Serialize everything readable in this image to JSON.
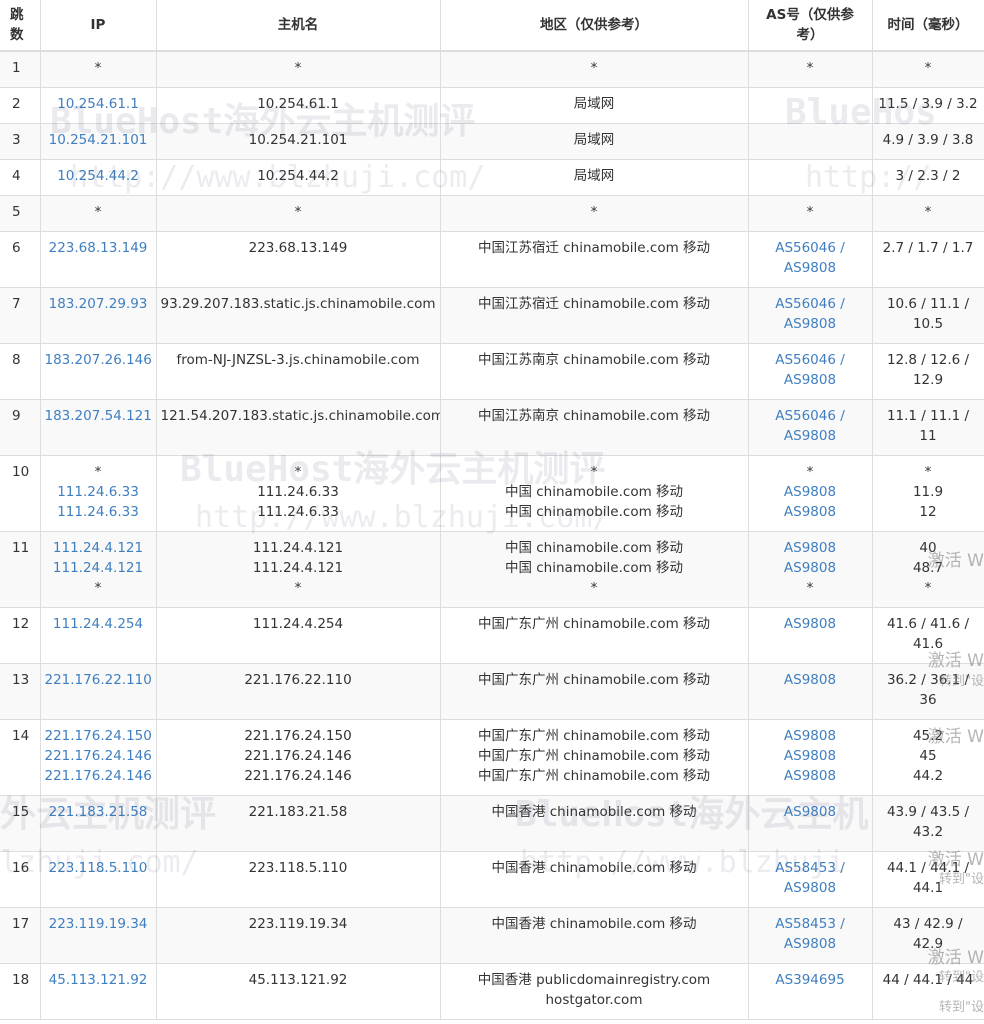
{
  "headers": {
    "hop": "跳\n数",
    "ip": "IP",
    "host": "主机名",
    "region": "地区（仅供参考）",
    "as": "AS号（仅供参\n考）",
    "time": "时间（毫秒）"
  },
  "rows": [
    {
      "hop": "1",
      "ip": [
        "*"
      ],
      "host": [
        "*"
      ],
      "region": [
        "*"
      ],
      "as": [
        "*"
      ],
      "time": [
        "*"
      ]
    },
    {
      "hop": "2",
      "ip": [
        "10.254.61.1"
      ],
      "host": [
        "10.254.61.1"
      ],
      "region": [
        "局域网"
      ],
      "as": [
        ""
      ],
      "time": [
        "11.5 / 3.9 / 3.2"
      ]
    },
    {
      "hop": "3",
      "ip": [
        "10.254.21.101"
      ],
      "host": [
        "10.254.21.101"
      ],
      "region": [
        "局域网"
      ],
      "as": [
        ""
      ],
      "time": [
        "4.9 / 3.9 / 3.8"
      ]
    },
    {
      "hop": "4",
      "ip": [
        "10.254.44.2"
      ],
      "host": [
        "10.254.44.2"
      ],
      "region": [
        "局域网"
      ],
      "as": [
        ""
      ],
      "time": [
        "3 / 2.3 / 2"
      ]
    },
    {
      "hop": "5",
      "ip": [
        "*"
      ],
      "host": [
        "*"
      ],
      "region": [
        "*"
      ],
      "as": [
        "*"
      ],
      "time": [
        "*"
      ]
    },
    {
      "hop": "6",
      "ip": [
        "223.68.13.149"
      ],
      "host": [
        "223.68.13.149"
      ],
      "region": [
        "中国江苏宿迁 chinamobile.com 移动"
      ],
      "as": [
        "AS56046 /",
        "AS9808"
      ],
      "time": [
        "2.7 / 1.7 / 1.7"
      ]
    },
    {
      "hop": "7",
      "ip": [
        "183.207.29.93"
      ],
      "host": [
        "93.29.207.183.static.js.chinamobile.com"
      ],
      "region": [
        "中国江苏宿迁 chinamobile.com 移动"
      ],
      "as": [
        "AS56046 /",
        "AS9808"
      ],
      "time": [
        "10.6 / 11.1 /",
        "10.5"
      ]
    },
    {
      "hop": "8",
      "ip": [
        "183.207.26.146"
      ],
      "host": [
        "from-NJ-JNZSL-3.js.chinamobile.com"
      ],
      "region": [
        "中国江苏南京 chinamobile.com 移动"
      ],
      "as": [
        "AS56046 /",
        "AS9808"
      ],
      "time": [
        "12.8 / 12.6 /",
        "12.9"
      ]
    },
    {
      "hop": "9",
      "ip": [
        "183.207.54.121"
      ],
      "host": [
        "121.54.207.183.static.js.chinamobile.com"
      ],
      "region": [
        "中国江苏南京 chinamobile.com 移动"
      ],
      "as": [
        "AS56046 /",
        "AS9808"
      ],
      "time": [
        "11.1 / 11.1 /",
        "11"
      ]
    },
    {
      "hop": "10",
      "ip": [
        "*",
        "111.24.6.33",
        "111.24.6.33"
      ],
      "host": [
        "*",
        "111.24.6.33",
        "111.24.6.33"
      ],
      "region": [
        "*",
        "中国 chinamobile.com 移动",
        "中国 chinamobile.com 移动"
      ],
      "as": [
        "*",
        "AS9808",
        "AS9808"
      ],
      "time": [
        "*",
        "11.9",
        "12"
      ]
    },
    {
      "hop": "11",
      "ip": [
        "111.24.4.121",
        "111.24.4.121",
        "*"
      ],
      "host": [
        "111.24.4.121",
        "111.24.4.121",
        "*"
      ],
      "region": [
        "中国 chinamobile.com 移动",
        "中国 chinamobile.com 移动",
        "*"
      ],
      "as": [
        "AS9808",
        "AS9808",
        "*"
      ],
      "time": [
        "40",
        "48.7",
        "*"
      ]
    },
    {
      "hop": "12",
      "ip": [
        "111.24.4.254"
      ],
      "host": [
        "111.24.4.254"
      ],
      "region": [
        "中国广东广州 chinamobile.com 移动"
      ],
      "as": [
        "AS9808"
      ],
      "time": [
        "41.6 / 41.6 /",
        "41.6"
      ]
    },
    {
      "hop": "13",
      "ip": [
        "221.176.22.110"
      ],
      "host": [
        "221.176.22.110"
      ],
      "region": [
        "中国广东广州 chinamobile.com 移动"
      ],
      "as": [
        "AS9808"
      ],
      "time": [
        "36.2 / 36.1 /",
        "36"
      ]
    },
    {
      "hop": "14",
      "ip": [
        "221.176.24.150",
        "221.176.24.146",
        "221.176.24.146"
      ],
      "host": [
        "221.176.24.150",
        "221.176.24.146",
        "221.176.24.146"
      ],
      "region": [
        "中国广东广州 chinamobile.com 移动",
        "中国广东广州 chinamobile.com 移动",
        "中国广东广州 chinamobile.com 移动"
      ],
      "as": [
        "AS9808",
        "AS9808",
        "AS9808"
      ],
      "time": [
        "45.2",
        "45",
        "44.2"
      ]
    },
    {
      "hop": "15",
      "ip": [
        "221.183.21.58"
      ],
      "host": [
        "221.183.21.58"
      ],
      "region": [
        "中国香港 chinamobile.com 移动"
      ],
      "as": [
        "AS9808"
      ],
      "time": [
        "43.9 / 43.5 /",
        "43.2"
      ]
    },
    {
      "hop": "16",
      "ip": [
        "223.118.5.110"
      ],
      "host": [
        "223.118.5.110"
      ],
      "region": [
        "中国香港 chinamobile.com 移动"
      ],
      "as": [
        "AS58453 /",
        "AS9808"
      ],
      "time": [
        "44.1 / 44.1 /",
        "44.1"
      ]
    },
    {
      "hop": "17",
      "ip": [
        "223.119.19.34"
      ],
      "host": [
        "223.119.19.34"
      ],
      "region": [
        "中国香港 chinamobile.com 移动"
      ],
      "as": [
        "AS58453 /",
        "AS9808"
      ],
      "time": [
        "43 / 42.9 /",
        "42.9"
      ]
    },
    {
      "hop": "18",
      "ip": [
        "45.113.121.92"
      ],
      "host": [
        "45.113.121.92"
      ],
      "region": [
        "中国香港 publicdomainregistry.com",
        "hostgator.com"
      ],
      "as": [
        "AS394695"
      ],
      "time": [
        "44 / 44.1 / 44"
      ]
    }
  ],
  "watermarks": {
    "brand": "BlueHost海外云主机测评",
    "url": "http://www.blzhuji.com/",
    "brand_partial_right": "BlueHos",
    "url_partial_right": "http://",
    "brand_partial_left": "外云主机测评",
    "url_partial_left": "lzhuji.com/",
    "brand_partial_mid": "BlueHost海外云主机",
    "url_partial_mid": "http://www.blzhuji",
    "activate": "激活 W",
    "goto": "转到\"设"
  },
  "colors": {
    "link": "#3f7fc0",
    "text": "#333333",
    "border": "#dddddd",
    "alt_row": "#f9f9f9"
  }
}
